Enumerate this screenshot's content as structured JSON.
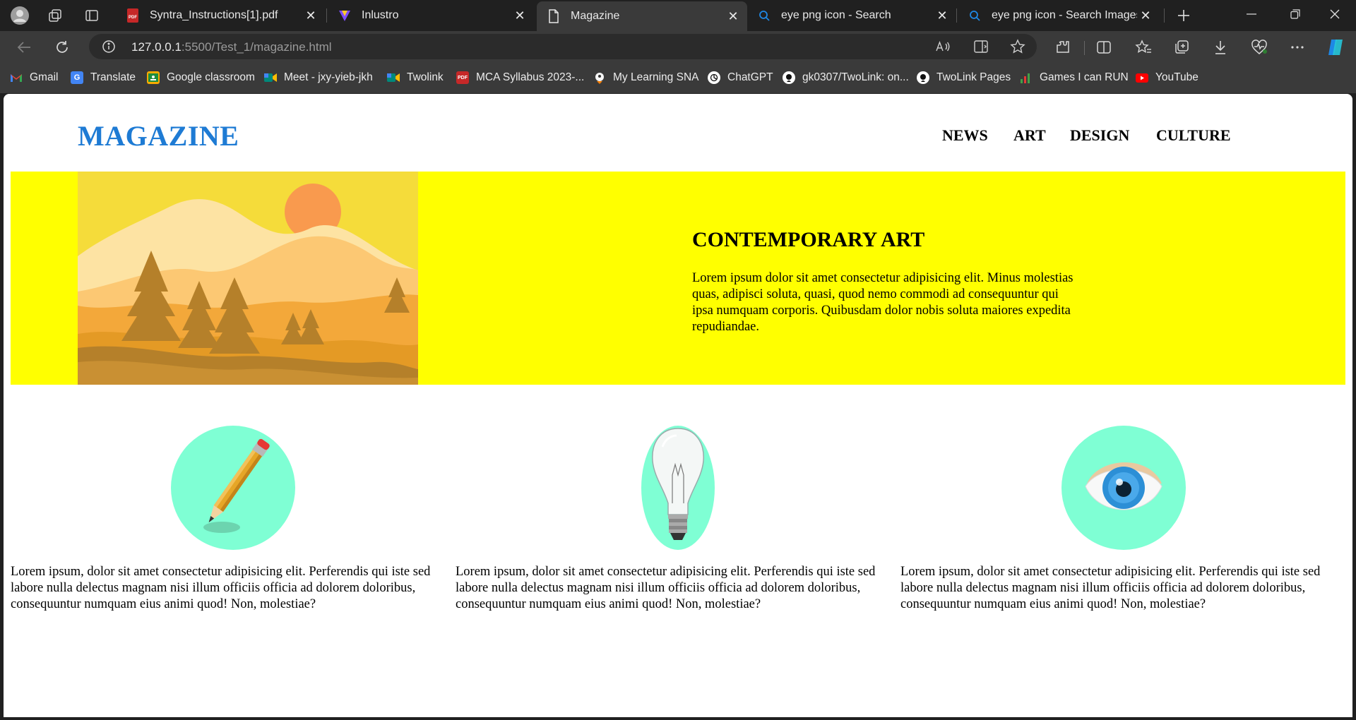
{
  "browser": {
    "tabs": [
      {
        "title": "Syntra_Instructions[1].pdf",
        "icon": "pdf-icon"
      },
      {
        "title": "Inlustro",
        "icon": "inlustro-logo-icon"
      },
      {
        "title": "Magazine",
        "icon": "page-icon"
      },
      {
        "title": "eye png icon - Search",
        "icon": "search-icon"
      },
      {
        "title": "eye png icon - Search Images",
        "icon": "search-icon"
      }
    ],
    "url_host": "127.0.0.1",
    "url_path": ":5500/Test_1/magazine.html",
    "bookmarks": [
      {
        "label": "Gmail",
        "icon": "gmail-icon",
        "color": "#ea4335"
      },
      {
        "label": "Translate",
        "icon": "translate-icon",
        "color": "#4285f4"
      },
      {
        "label": "Google classroom",
        "icon": "classroom-icon",
        "color": "#f9ab00"
      },
      {
        "label": "Meet - jxy-yieb-jkh",
        "icon": "meet-icon",
        "color": "#00897b"
      },
      {
        "label": "Twolink",
        "icon": "meet-icon",
        "color": "#00897b"
      },
      {
        "label": "MCA Syllabus 2023-...",
        "icon": "pdf-icon",
        "color": "#c62828"
      },
      {
        "label": "My Learning SNA",
        "icon": "learning-icon",
        "color": "#f5f5f5"
      },
      {
        "label": "ChatGPT",
        "icon": "chatgpt-icon",
        "color": "#ffffff"
      },
      {
        "label": "gk0307/TwoLink: on...",
        "icon": "github-icon",
        "color": "#ffffff"
      },
      {
        "label": "TwoLink Pages",
        "icon": "github-icon",
        "color": "#ffffff"
      },
      {
        "label": "Games I can RUN",
        "icon": "games-icon",
        "color": "#43a047"
      },
      {
        "label": "YouTube",
        "icon": "youtube-icon",
        "color": "#ff0000"
      }
    ]
  },
  "page": {
    "logo": "MAGAZINE",
    "nav": [
      "NEWS",
      "ART",
      "DESIGN",
      "CULTURE"
    ],
    "hero": {
      "title": "CONTEMPORARY ART",
      "text": "Lorem ipsum dolor sit amet consectetur adipisicing elit. Minus molestias quas, adipisci soluta, quasi, quod nemo commodi ad consequuntur qui ipsa numquam corporis. Quibusdam dolor nobis soluta maiores expedita repudiandae."
    },
    "features": [
      {
        "icon": "pencil-icon",
        "text": "Lorem ipsum, dolor sit amet consectetur adipisicing elit. Perferendis qui iste sed labore nulla delectus magnam nisi illum officiis officia ad dolorem doloribus, consequuntur numquam eius animi quod! Non, molestiae?"
      },
      {
        "icon": "light-bulb-icon",
        "text": "Lorem ipsum, dolor sit amet consectetur adipisicing elit. Perferendis qui iste sed labore nulla delectus magnam nisi illum officiis officia ad dolorem doloribus, consequuntur numquam eius animi quod! Non, molestiae?"
      },
      {
        "icon": "eye-icon",
        "text": "Lorem ipsum, dolor sit amet consectetur adipisicing elit. Perferendis qui iste sed labore nulla delectus magnam nisi illum officiis officia ad dolorem doloribus, consequuntur numquam eius animi quod! Non, molestiae?"
      }
    ],
    "colors": {
      "logo": "#1e7bd4",
      "hero_bg": "#ffff00",
      "icon_circle": "#7fffd4"
    }
  }
}
